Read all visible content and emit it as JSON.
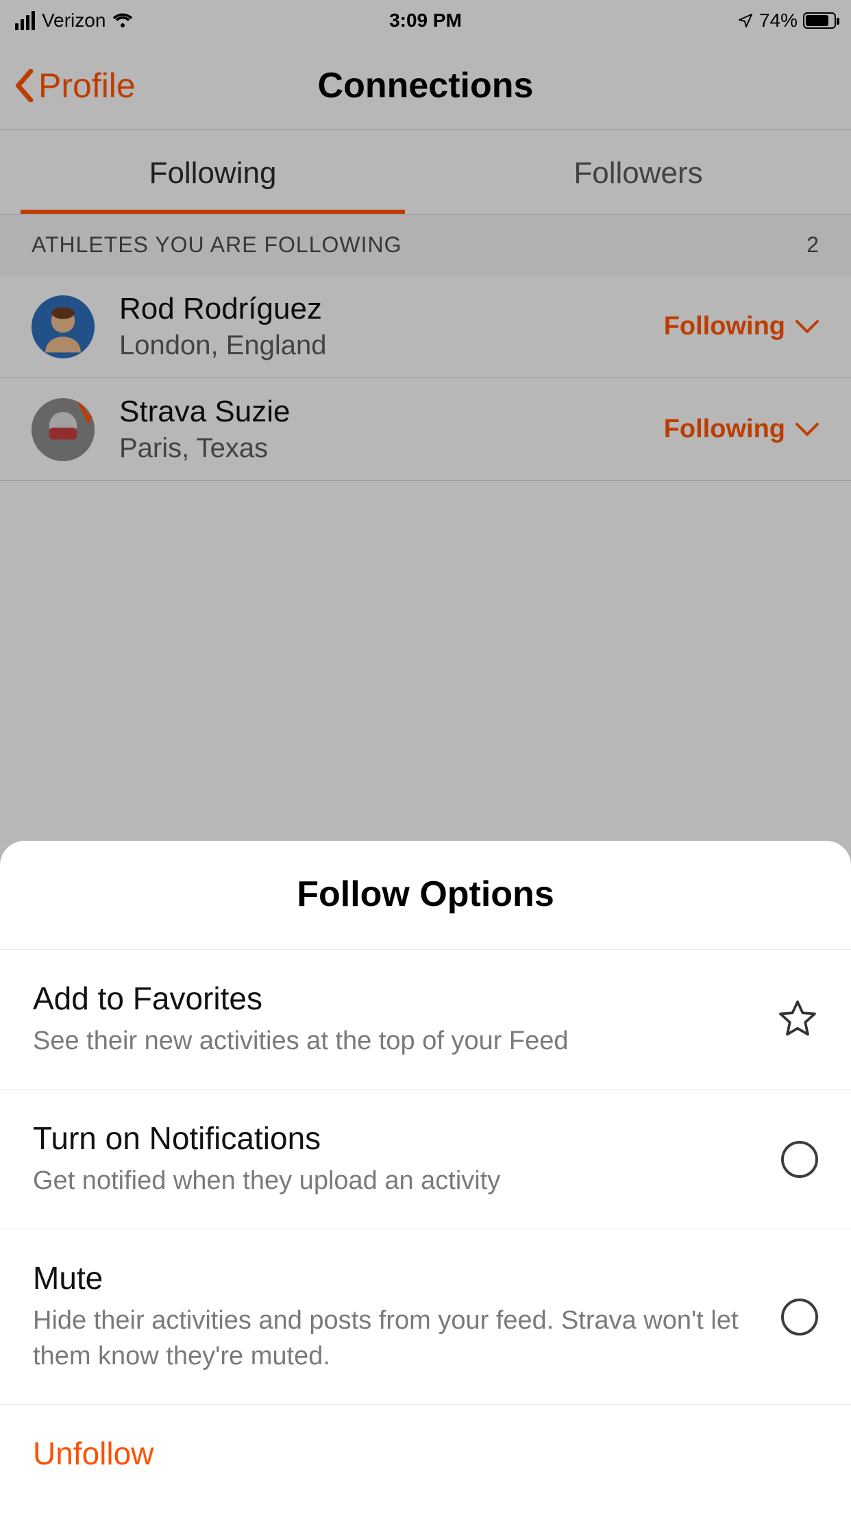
{
  "status": {
    "carrier": "Verizon",
    "time": "3:09 PM",
    "battery_pct": "74%"
  },
  "nav": {
    "back_label": "Profile",
    "title": "Connections"
  },
  "tabs": {
    "following": "Following",
    "followers": "Followers"
  },
  "section": {
    "header": "ATHLETES YOU ARE FOLLOWING",
    "count": "2"
  },
  "athletes": [
    {
      "name": "Rod Rodríguez",
      "location": "London, England",
      "status": "Following"
    },
    {
      "name": "Strava Suzie",
      "location": "Paris, Texas",
      "status": "Following"
    }
  ],
  "sheet": {
    "title": "Follow Options",
    "options": [
      {
        "title": "Add to Favorites",
        "sub": "See their new activities at the top of your Feed"
      },
      {
        "title": "Turn on Notifications",
        "sub": "Get notified when they upload an activity"
      },
      {
        "title": "Mute",
        "sub": "Hide their activities and posts from your feed. Strava won't let them know they're muted."
      }
    ],
    "unfollow": "Unfollow"
  }
}
